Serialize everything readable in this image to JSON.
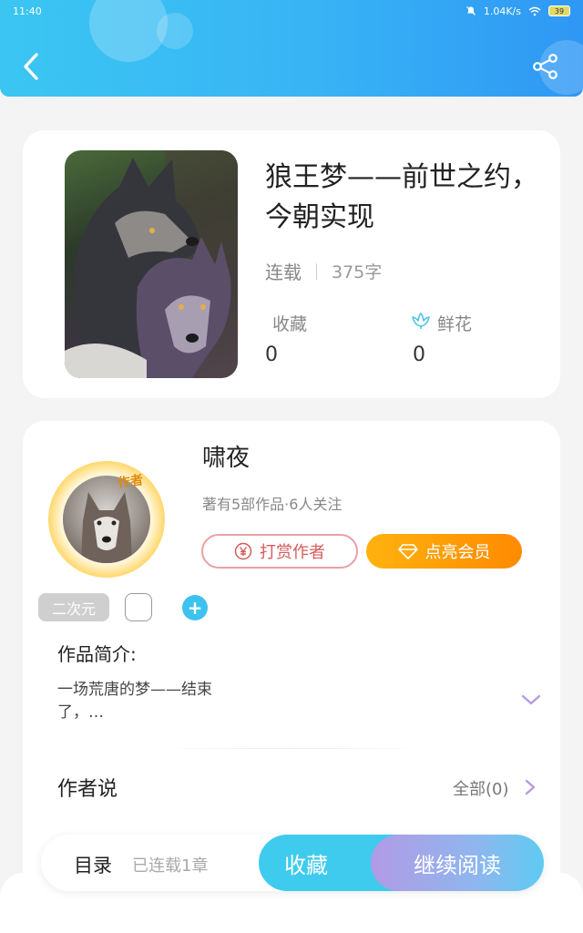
{
  "statusbar": {
    "time": "11:40",
    "network_speed": "1.04K/s",
    "battery": "39"
  },
  "header": {
    "back_icon": "chevron-left-icon",
    "share_icon": "share-icon",
    "accent": "#38b3f5"
  },
  "book": {
    "title": "狼王梦——前世之约，今朝实现",
    "status": "连载",
    "word_count": "375字",
    "stats": [
      {
        "label": "收藏",
        "value": "0"
      },
      {
        "label": "鲜花",
        "value": "0",
        "icon": "flower-icon"
      }
    ]
  },
  "author": {
    "badge": "作者",
    "name": "啸夜",
    "summary": "著有5部作品·6人关注",
    "tip_button": "打赏作者",
    "vip_button": "点亮会员"
  },
  "tags": {
    "items": [
      "二次元"
    ],
    "add_icon": "plus-icon"
  },
  "intro": {
    "title": "作品简介:",
    "text": "一场荒唐的梦——结束了，…"
  },
  "author_says": {
    "title": "作者说",
    "all_label": "全部(0)"
  },
  "bottom_bar": {
    "toc_label": "目录",
    "chapter_count": "已连载1章",
    "collect_button": "收藏",
    "read_button": "继续阅读"
  }
}
